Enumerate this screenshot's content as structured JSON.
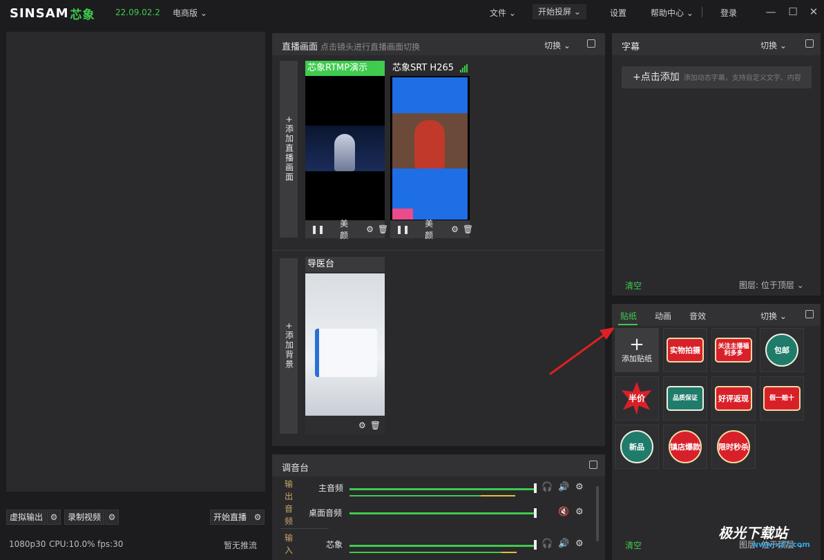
{
  "app": {
    "logo_text": "SINSAM",
    "logo_cn": "芯象",
    "version": "22.09.02.2",
    "edition": "电商版"
  },
  "menu": {
    "file": "文件",
    "cast": "开始投屏",
    "settings": "设置",
    "help": "帮助中心",
    "login": "登录"
  },
  "left": {
    "virtual_output": "虚拟输出",
    "record": "录制视频",
    "start_live": "开始直播",
    "resolution": "1080p30",
    "cpu": "CPU:10.0%",
    "fps": "fps:30",
    "stream_status": "暂无推流"
  },
  "live_panel": {
    "title": "直播画面",
    "hint": "点击镜头进行直播画面切换",
    "switch": "切换",
    "add_scene": "+添加直播画面",
    "cameras": [
      {
        "name": "芯象RTMP演示",
        "beauty": "美颜"
      },
      {
        "name": "芯象SRT H265",
        "beauty": "美颜"
      }
    ],
    "add_bg": "+添加背景",
    "background": {
      "name": "导医台"
    }
  },
  "mixer": {
    "title": "调音台",
    "output_label": "输出音频",
    "input_label": "输入",
    "channels": [
      {
        "name": "主音频"
      },
      {
        "name": "桌面音频"
      },
      {
        "name": "芯象"
      }
    ]
  },
  "subtitle_panel": {
    "title": "字幕",
    "switch": "切换",
    "add": "+点击添加",
    "add_hint": "添加动态字幕，支持自定义文字、内容",
    "clear": "清空",
    "layer_label": "图层:",
    "layer_value": "位于顶层"
  },
  "sticker_panel": {
    "tabs": [
      "贴纸",
      "动画",
      "音效"
    ],
    "switch": "切换",
    "add": "添加贴纸",
    "stickers": [
      "实物拍摄",
      "关注主播福利多多",
      "包邮",
      "半价",
      "品质保证",
      "好评返现",
      "假一赔十",
      "新品",
      "镇店爆款",
      "限时秒杀"
    ],
    "clear": "清空",
    "layer_label": "图层:",
    "layer_value": "位于顶层"
  },
  "watermark": {
    "text": "极光下载站",
    "url": "www.xz7.com"
  }
}
